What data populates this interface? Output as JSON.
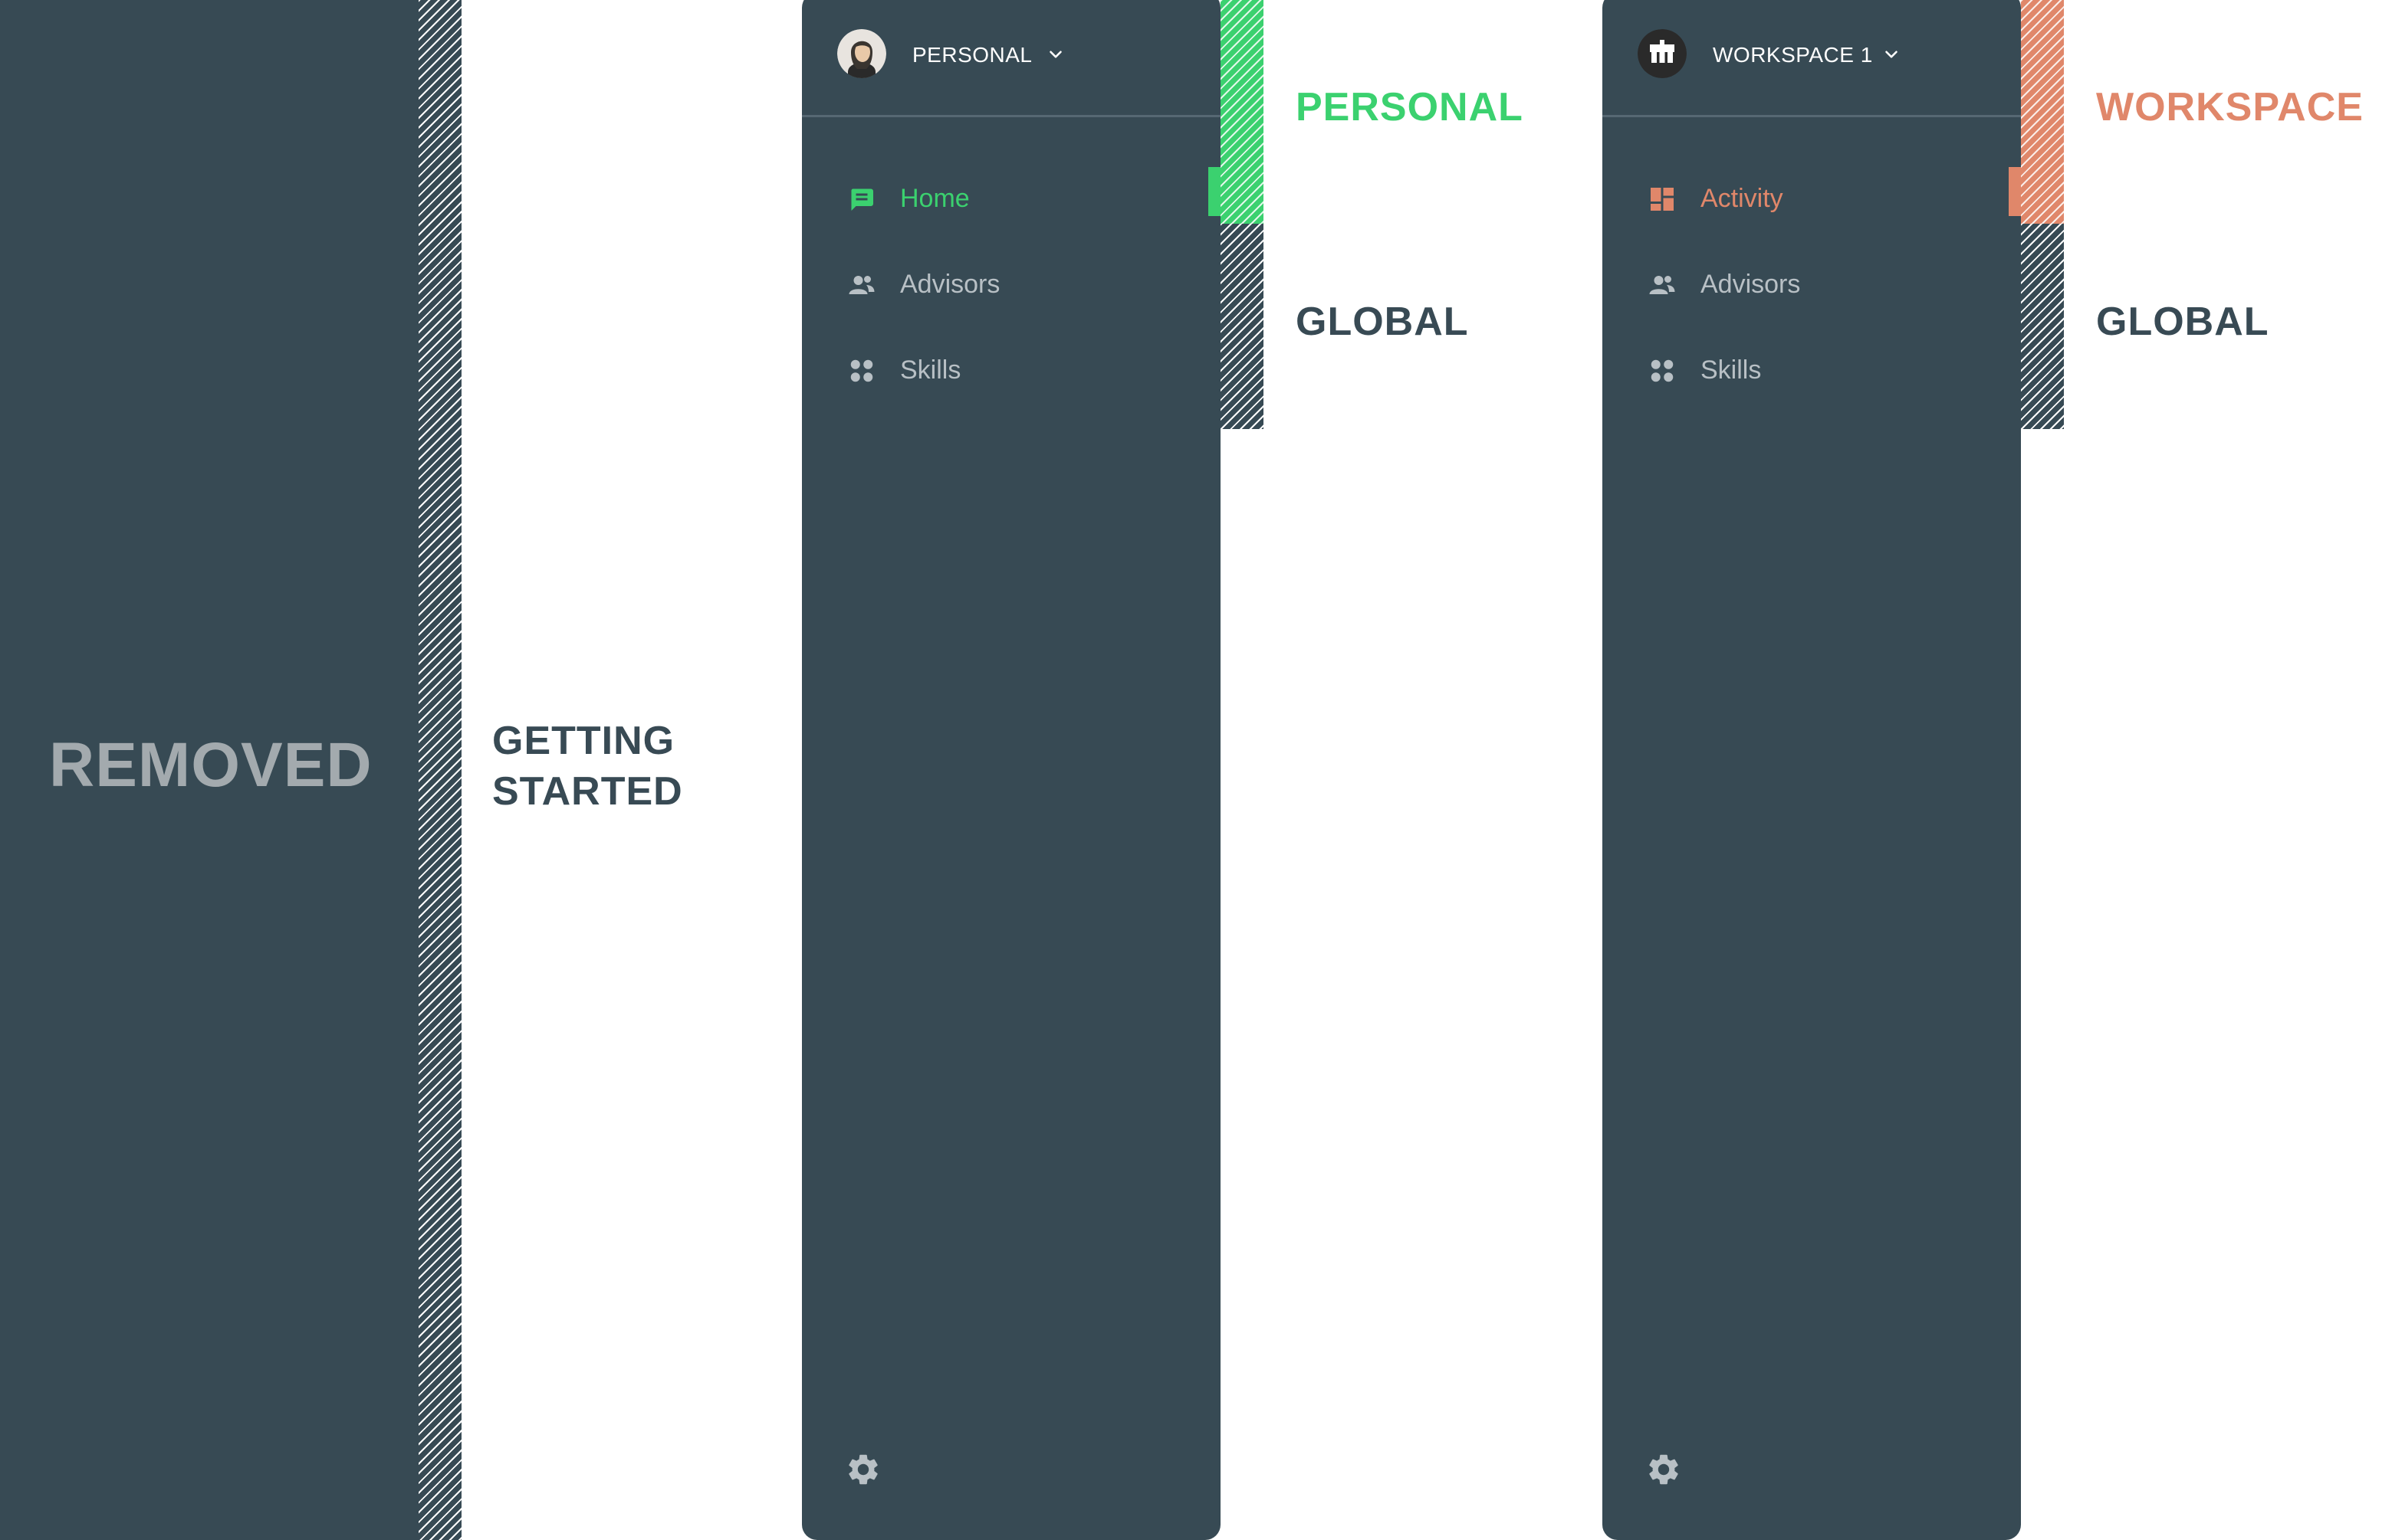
{
  "colors": {
    "sidebar_bg": "#374a54",
    "personal_accent": "#3bd16f",
    "workspace_accent": "#e0876a",
    "muted_text": "#b8c0c5",
    "annotation_text": "#384a54"
  },
  "removed": {
    "label": "REMOVED",
    "annotation_line1": "GETTING",
    "annotation_line2": "STARTED"
  },
  "personal_sidebar": {
    "workspace_name": "PERSONAL",
    "avatar_icon": "user-photo",
    "items": [
      {
        "label": "Home",
        "icon": "chat-icon",
        "active": true
      },
      {
        "label": "Advisors",
        "icon": "people-icon",
        "active": false
      },
      {
        "label": "Skills",
        "icon": "grid-icon",
        "active": false
      }
    ],
    "settings_icon": "gear-icon",
    "section_label_top": "PERSONAL",
    "section_label_bottom": "GLOBAL"
  },
  "workspace_sidebar": {
    "workspace_name": "WORKSPACE 1",
    "avatar_icon": "workspace-logo",
    "items": [
      {
        "label": "Activity",
        "icon": "dashboard-icon",
        "active": true
      },
      {
        "label": "Advisors",
        "icon": "people-icon",
        "active": false
      },
      {
        "label": "Skills",
        "icon": "grid-icon",
        "active": false
      }
    ],
    "settings_icon": "gear-icon",
    "section_label_top": "WORKSPACE",
    "section_label_bottom": "GLOBAL"
  }
}
